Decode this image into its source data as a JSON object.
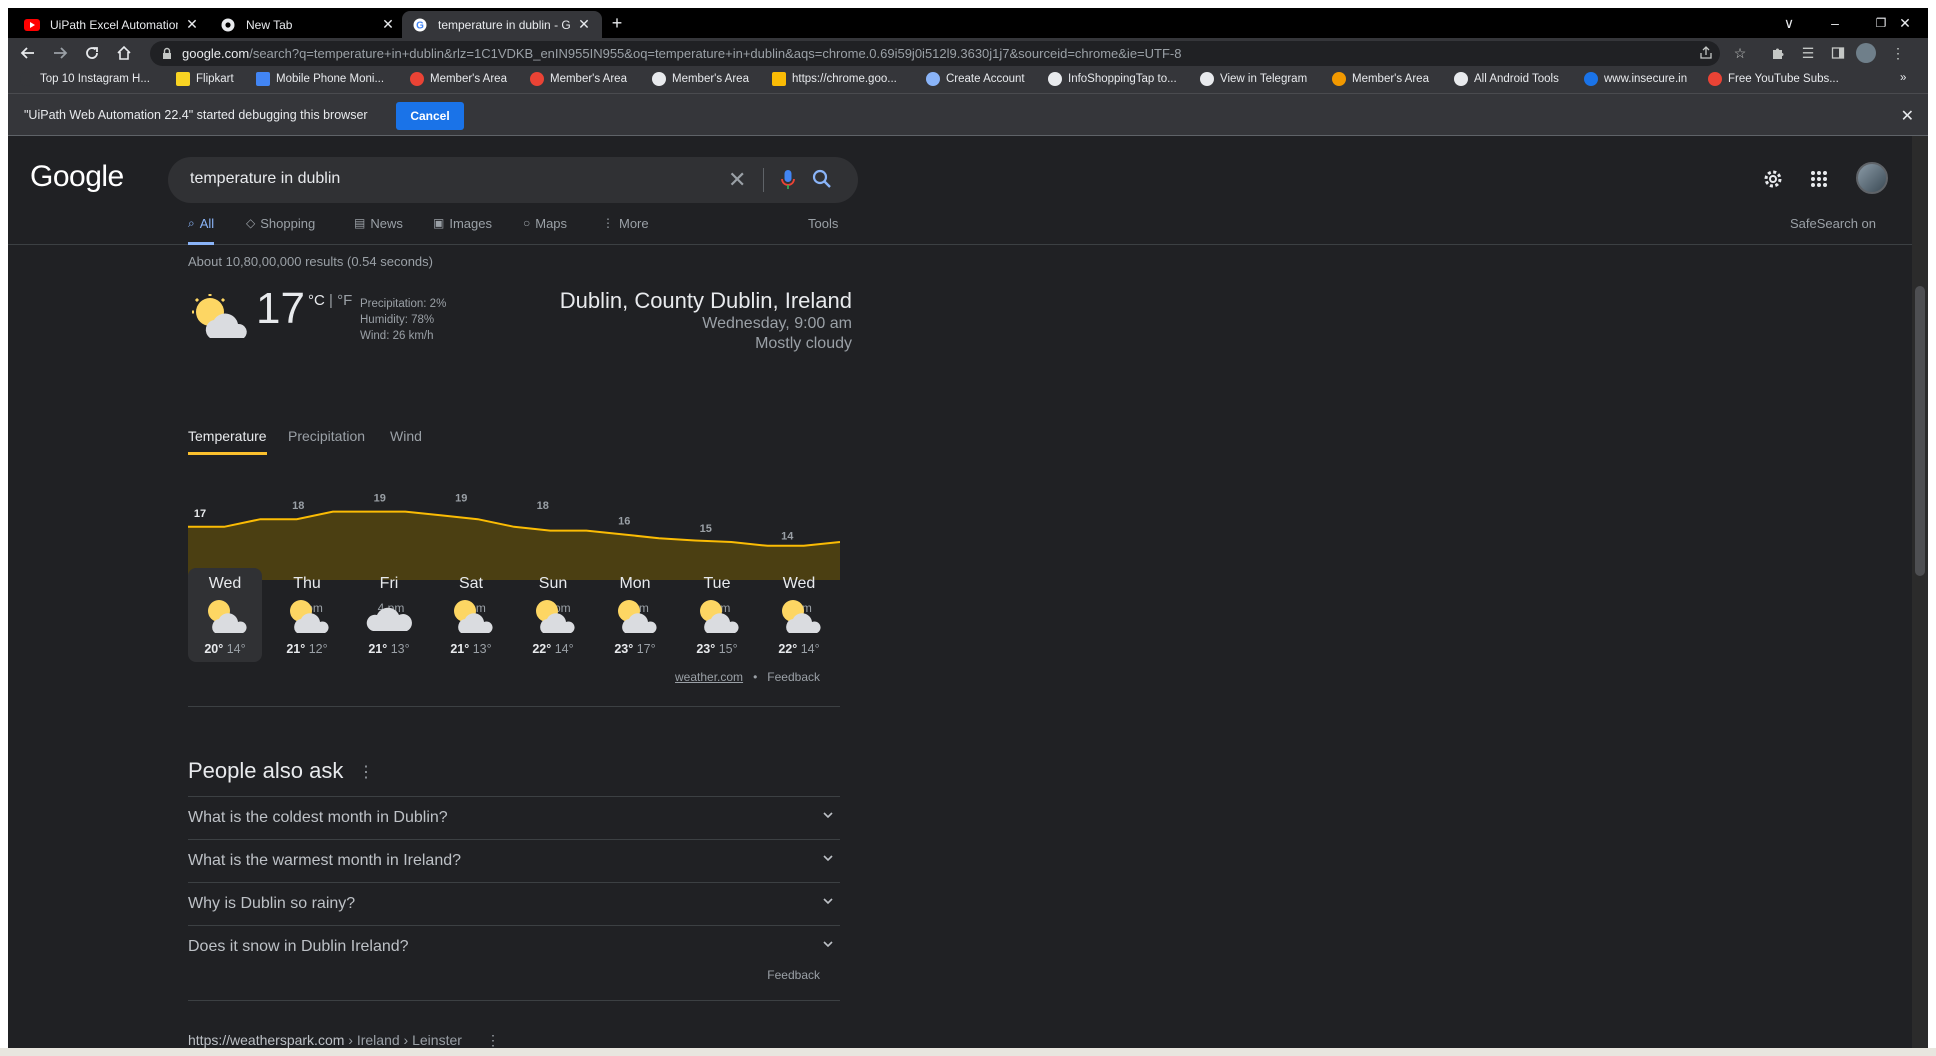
{
  "tabs": [
    {
      "title": "UiPath Excel Automation:Excel A…",
      "icon": "youtube-icon"
    },
    {
      "title": "New Tab",
      "icon": "chrome-icon"
    },
    {
      "title": "temperature in dublin - Google S…",
      "icon": "google-icon"
    }
  ],
  "window": {
    "new_tab": "+",
    "minimize": "–",
    "restore": "❐",
    "close": "✕",
    "dropdown": "∨"
  },
  "address": {
    "host": "google.com",
    "path": "/search?q=temperature+in+dublin&rlz=1C1VDKB_enIN955IN955&oq=temperature+in+dublin&aqs=chrome.0.69i59j0i512l9.3630j1j7&sourceid=chrome&ie=UTF-8"
  },
  "bookmarks": [
    {
      "label": "Top 10 Instagram H...",
      "color": "#35363a"
    },
    {
      "label": "Flipkart",
      "color": "#f9d423"
    },
    {
      "label": "Mobile Phone Moni...",
      "color": "#4285f4"
    },
    {
      "label": "Member's Area",
      "color": "#ea4335"
    },
    {
      "label": "Member's Area",
      "color": "#ea4335"
    },
    {
      "label": "Member's Area",
      "color": "#e8eaed"
    },
    {
      "label": "https://chrome.goo...",
      "color": "#fbbc05"
    },
    {
      "label": "Create Account",
      "color": "#8ab4f8"
    },
    {
      "label": "InfoShoppingTap to...",
      "color": "#e8eaed"
    },
    {
      "label": "View in Telegram",
      "color": "#e8eaed"
    },
    {
      "label": "Member's Area",
      "color": "#f29900"
    },
    {
      "label": "All Android Tools",
      "color": "#e8eaed"
    },
    {
      "label": "www.insecure.in",
      "color": "#1a73e8"
    },
    {
      "label": "Free YouTube Subs...",
      "color": "#ea4335"
    }
  ],
  "bookmarks_more": "»",
  "infobar": {
    "message": "\"UiPath Web Automation 22.4\" started debugging this browser",
    "button": "Cancel",
    "close": "✕"
  },
  "google": {
    "logo": "Google",
    "query": "temperature in dublin",
    "clear": "✕",
    "tabs": [
      {
        "label": "All",
        "icon": "⌕"
      },
      {
        "label": "Shopping",
        "icon": "◇"
      },
      {
        "label": "News",
        "icon": "▤"
      },
      {
        "label": "Images",
        "icon": "▣"
      },
      {
        "label": "Maps",
        "icon": "○"
      },
      {
        "label": "More",
        "icon": "⋮"
      }
    ],
    "tools": "Tools",
    "safesearch": "SafeSearch on",
    "results_count": "About 10,80,00,000 results (0.54 seconds)"
  },
  "weather": {
    "temp": "17",
    "unit_c": "°C",
    "unit_sep": " | ",
    "unit_f": "°F",
    "precipitation": "Precipitation: 2%",
    "humidity": "Humidity: 78%",
    "wind": "Wind: 26 km/h",
    "location": "Dublin, County Dublin, Ireland",
    "time": "Wednesday, 9:00 am",
    "condition": "Mostly cloudy",
    "tabs": [
      "Temperature",
      "Precipitation",
      "Wind"
    ],
    "days": [
      {
        "name": "Wed",
        "hi": "20°",
        "lo": "14°",
        "icon": "partly-cloudy-icon"
      },
      {
        "name": "Thu",
        "hi": "21°",
        "lo": "12°",
        "icon": "partly-cloudy-icon"
      },
      {
        "name": "Fri",
        "hi": "21°",
        "lo": "13°",
        "icon": "cloudy-icon"
      },
      {
        "name": "Sat",
        "hi": "21°",
        "lo": "13°",
        "icon": "partly-cloudy-icon"
      },
      {
        "name": "Sun",
        "hi": "22°",
        "lo": "14°",
        "icon": "partly-cloudy-icon"
      },
      {
        "name": "Mon",
        "hi": "23°",
        "lo": "17°",
        "icon": "partly-cloudy-icon"
      },
      {
        "name": "Tue",
        "hi": "23°",
        "lo": "15°",
        "icon": "partly-cloudy-icon"
      },
      {
        "name": "Wed",
        "hi": "22°",
        "lo": "14°",
        "icon": "partly-cloudy-icon"
      }
    ],
    "source": "weather.com",
    "dot": "•",
    "feedback": "Feedback"
  },
  "chart_data": {
    "type": "area",
    "x": [
      "10 am",
      "1 pm",
      "4 pm",
      "7 pm",
      "10 pm",
      "1 am",
      "4 am",
      "7 am"
    ],
    "labels": [
      "17",
      "18",
      "19",
      "19",
      "18",
      "16",
      "15",
      "14"
    ],
    "values": [
      17,
      18,
      19,
      19,
      18,
      16,
      15,
      14
    ],
    "line_values": [
      17,
      17,
      18,
      18,
      19,
      19,
      19,
      18.5,
      18,
      17,
      16.5,
      16.5,
      16,
      15.5,
      15.2,
      15,
      14.5,
      14.5,
      15
    ],
    "ylim": [
      10,
      20
    ],
    "line_color": "#fbbc04",
    "fill_color": "#4b3f12"
  },
  "paa": {
    "title": "People also ask",
    "kebab": "⋮",
    "questions": [
      "What is the coldest month in Dublin?",
      "What is the warmest month in Ireland?",
      "Why is Dublin so rainy?",
      "Does it snow in Dublin Ireland?"
    ],
    "feedback": "Feedback"
  },
  "result": {
    "url": "https://weatherspark.com",
    "path": " › Ireland › Leinster",
    "kebab": "⋮"
  }
}
